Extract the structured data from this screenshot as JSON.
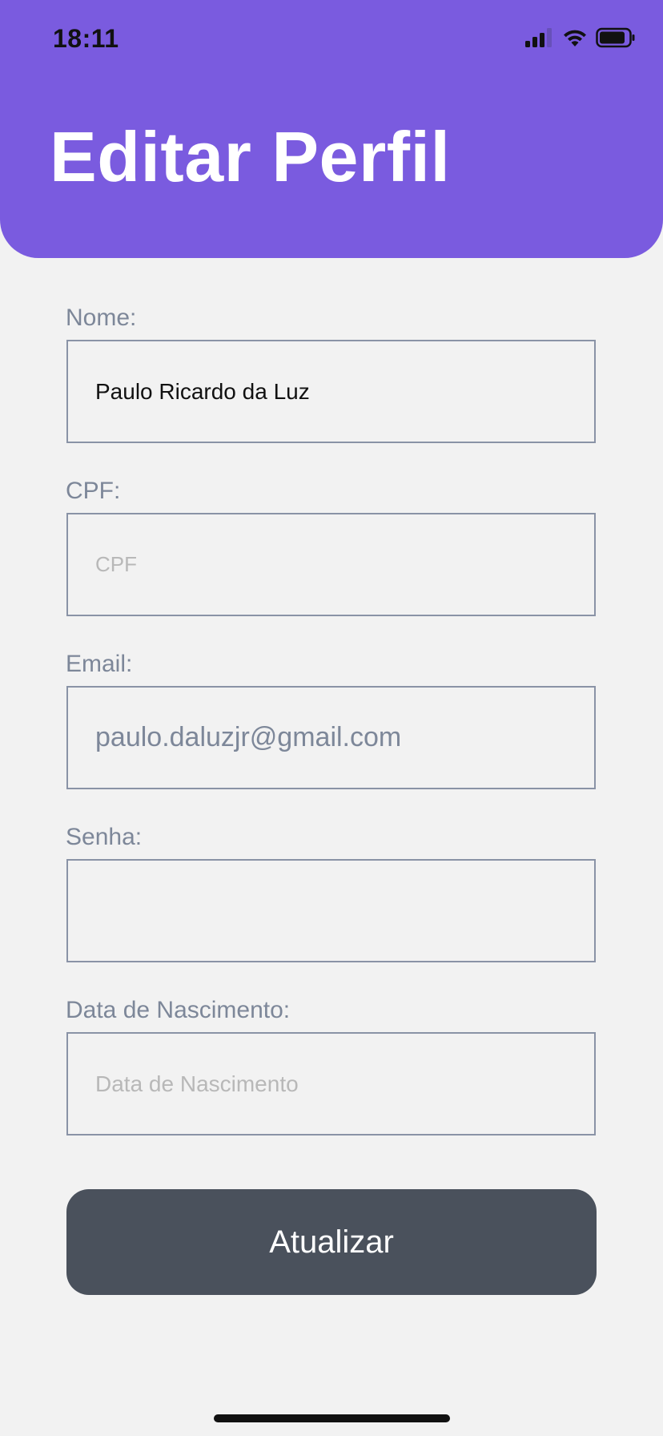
{
  "status_bar": {
    "time": "18:11",
    "icons": [
      "cellular-signal-icon",
      "wifi-icon",
      "battery-icon"
    ]
  },
  "header": {
    "title": "Editar Perfil",
    "background_color": "#7a5bdf"
  },
  "form": {
    "nome": {
      "label": "Nome:",
      "value": "Paulo Ricardo da Luz",
      "placeholder": ""
    },
    "cpf": {
      "label": "CPF:",
      "value": "",
      "placeholder": "CPF"
    },
    "email": {
      "label": "Email:",
      "value": "",
      "placeholder": "paulo.daluzjr@gmail.com"
    },
    "senha": {
      "label": "Senha:",
      "value": "",
      "placeholder": ""
    },
    "data_nascimento": {
      "label": "Data de Nascimento:",
      "value": "",
      "placeholder": "Data de Nascimento"
    },
    "submit_label": "Atualizar",
    "button_color": "#4a515c"
  }
}
